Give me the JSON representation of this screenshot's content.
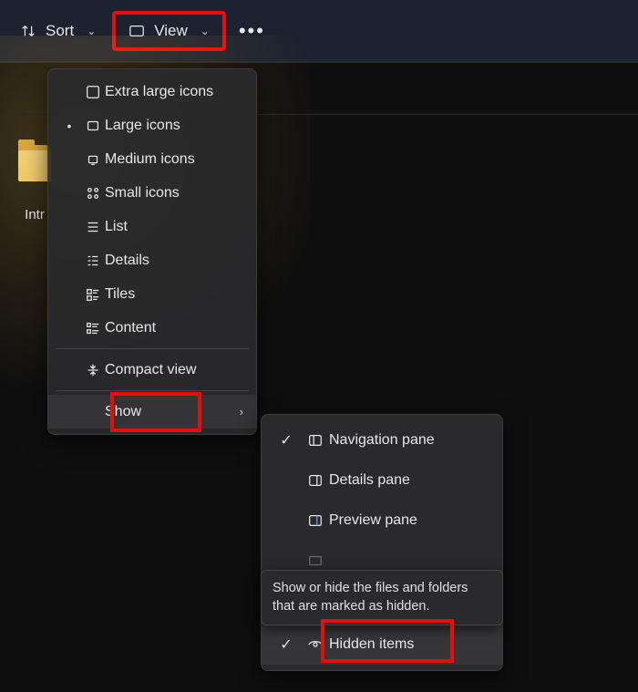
{
  "toolbar": {
    "sort_label": "Sort",
    "view_label": "View"
  },
  "folder": {
    "label": "Intr"
  },
  "view_menu": {
    "items": [
      {
        "label": "Extra large icons",
        "selected": false,
        "icon": "xl-icons"
      },
      {
        "label": "Large icons",
        "selected": true,
        "icon": "l-icons"
      },
      {
        "label": "Medium icons",
        "selected": false,
        "icon": "m-icons"
      },
      {
        "label": "Small icons",
        "selected": false,
        "icon": "s-icons"
      },
      {
        "label": "List",
        "selected": false,
        "icon": "list"
      },
      {
        "label": "Details",
        "selected": false,
        "icon": "details"
      },
      {
        "label": "Tiles",
        "selected": false,
        "icon": "tiles"
      },
      {
        "label": "Content",
        "selected": false,
        "icon": "content"
      }
    ],
    "compact_label": "Compact view",
    "show_label": "Show"
  },
  "show_submenu": {
    "items": [
      {
        "label": "Navigation pane",
        "checked": true
      },
      {
        "label": "Details pane",
        "checked": false
      },
      {
        "label": "Preview pane",
        "checked": false
      },
      {
        "label": "",
        "checked": false
      },
      {
        "label": "Hidden items",
        "checked": true
      }
    ]
  },
  "tooltip_text": "Show or hide the files and folders that are marked as hidden."
}
